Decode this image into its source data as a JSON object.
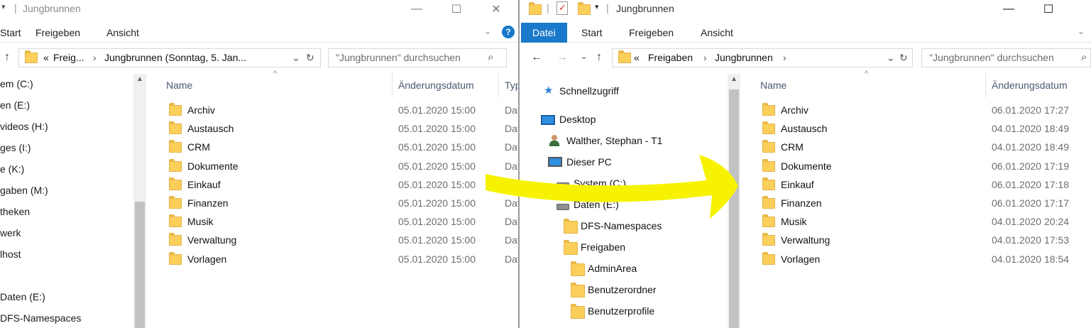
{
  "left": {
    "title": "Jungbrunnen",
    "tabs": [
      "Start",
      "Freigeben",
      "Ansicht"
    ],
    "help_label": "?",
    "address": {
      "prefix": "«",
      "parts": [
        "Freig...",
        "Jungbrunnen (Sonntag, 5. Jan..."
      ]
    },
    "search_placeholder": "\"Jungbrunnen\" durchsuchen",
    "columns": {
      "name": "Name",
      "date": "Änderungsdatum",
      "type": "Typ"
    },
    "nav_items": [
      "em (C:)",
      "en (E:)",
      "videos (H:)",
      "ges (I:)",
      "e (K:)",
      "gaben (M:)",
      "theken",
      "werk",
      "lhost",
      "",
      "Daten (E:)",
      "DFS-Namespaces"
    ],
    "files": [
      {
        "name": "Archiv",
        "date": "05.01.2020 15:00",
        "type": "Dat"
      },
      {
        "name": "Austausch",
        "date": "05.01.2020 15:00",
        "type": "Dat"
      },
      {
        "name": "CRM",
        "date": "05.01.2020 15:00",
        "type": "Dat"
      },
      {
        "name": "Dokumente",
        "date": "05.01.2020 15:00",
        "type": "Dat"
      },
      {
        "name": "Einkauf",
        "date": "05.01.2020 15:00",
        "type": "Dat"
      },
      {
        "name": "Finanzen",
        "date": "05.01.2020 15:00",
        "type": "Dat"
      },
      {
        "name": "Musik",
        "date": "05.01.2020 15:00",
        "type": "Dat"
      },
      {
        "name": "Verwaltung",
        "date": "05.01.2020 15:00",
        "type": "Dat"
      },
      {
        "name": "Vorlagen",
        "date": "05.01.2020 15:00",
        "type": "Dat"
      }
    ]
  },
  "right": {
    "title": "Jungbrunnen",
    "tabs": [
      "Datei",
      "Start",
      "Freigeben",
      "Ansicht"
    ],
    "address": {
      "prefix": "«",
      "parts": [
        "Freigaben",
        "Jungbrunnen"
      ]
    },
    "search_placeholder": "\"Jungbrunnen\" durchsuchen",
    "columns": {
      "name": "Name",
      "date": "Änderungsdatum"
    },
    "nav_items": [
      {
        "label": "Schnellzugriff",
        "icon": "star-icon"
      },
      {
        "label": "Desktop",
        "icon": "desktop-icon"
      },
      {
        "label": "Walther, Stephan - T1",
        "icon": "user-icon"
      },
      {
        "label": "Dieser PC",
        "icon": "pc-icon"
      },
      {
        "label": "System (C:)",
        "icon": "drive-icon"
      },
      {
        "label": "Daten (E:)",
        "icon": "drive-icon"
      },
      {
        "label": "DFS-Namespaces",
        "icon": "folder-icon"
      },
      {
        "label": "Freigaben",
        "icon": "folder-icon"
      },
      {
        "label": "AdminArea",
        "icon": "folder-icon"
      },
      {
        "label": "Benutzerordner",
        "icon": "folder-icon"
      },
      {
        "label": "Benutzerprofile",
        "icon": "folder-icon"
      }
    ],
    "files": [
      {
        "name": "Archiv",
        "date": "06.01.2020 17:27"
      },
      {
        "name": "Austausch",
        "date": "04.01.2020 18:49"
      },
      {
        "name": "CRM",
        "date": "04.01.2020 18:49"
      },
      {
        "name": "Dokumente",
        "date": "06.01.2020 17:19"
      },
      {
        "name": "Einkauf",
        "date": "06.01.2020 17:18"
      },
      {
        "name": "Finanzen",
        "date": "06.01.2020 17:17"
      },
      {
        "name": "Musik",
        "date": "04.01.2020 20:24"
      },
      {
        "name": "Verwaltung",
        "date": "04.01.2020 17:53"
      },
      {
        "name": "Vorlagen",
        "date": "04.01.2020 18:54"
      }
    ]
  },
  "colors": {
    "accent": "#1979ca",
    "folder": "#fccf5b",
    "annotation_arrow": "#f7f300"
  }
}
